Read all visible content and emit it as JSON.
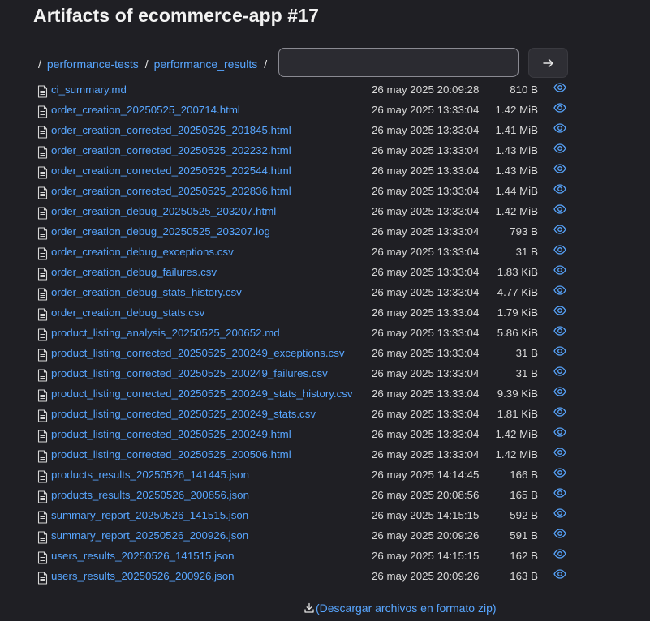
{
  "page_title": "Artifacts of ecommerce-app #17",
  "breadcrumb": {
    "root_separator": "/",
    "items": [
      "performance-tests",
      "performance_results"
    ],
    "separator": "/"
  },
  "path_input": {
    "value": "",
    "placeholder": ""
  },
  "go_button_icon": "arrow-right-icon",
  "files": [
    {
      "name": "ci_summary.md",
      "date": "26 may 2025 20:09:28",
      "size": "810 B"
    },
    {
      "name": "order_creation_20250525_200714.html",
      "date": "26 may 2025 13:33:04",
      "size": "1.42 MiB"
    },
    {
      "name": "order_creation_corrected_20250525_201845.html",
      "date": "26 may 2025 13:33:04",
      "size": "1.41 MiB"
    },
    {
      "name": "order_creation_corrected_20250525_202232.html",
      "date": "26 may 2025 13:33:04",
      "size": "1.43 MiB"
    },
    {
      "name": "order_creation_corrected_20250525_202544.html",
      "date": "26 may 2025 13:33:04",
      "size": "1.43 MiB"
    },
    {
      "name": "order_creation_corrected_20250525_202836.html",
      "date": "26 may 2025 13:33:04",
      "size": "1.44 MiB"
    },
    {
      "name": "order_creation_debug_20250525_203207.html",
      "date": "26 may 2025 13:33:04",
      "size": "1.42 MiB"
    },
    {
      "name": "order_creation_debug_20250525_203207.log",
      "date": "26 may 2025 13:33:04",
      "size": "793 B"
    },
    {
      "name": "order_creation_debug_exceptions.csv",
      "date": "26 may 2025 13:33:04",
      "size": "31 B"
    },
    {
      "name": "order_creation_debug_failures.csv",
      "date": "26 may 2025 13:33:04",
      "size": "1.83 KiB"
    },
    {
      "name": "order_creation_debug_stats_history.csv",
      "date": "26 may 2025 13:33:04",
      "size": "4.77 KiB"
    },
    {
      "name": "order_creation_debug_stats.csv",
      "date": "26 may 2025 13:33:04",
      "size": "1.79 KiB"
    },
    {
      "name": "product_listing_analysis_20250525_200652.md",
      "date": "26 may 2025 13:33:04",
      "size": "5.86 KiB"
    },
    {
      "name": "product_listing_corrected_20250525_200249_exceptions.csv",
      "date": "26 may 2025 13:33:04",
      "size": "31 B"
    },
    {
      "name": "product_listing_corrected_20250525_200249_failures.csv",
      "date": "26 may 2025 13:33:04",
      "size": "31 B"
    },
    {
      "name": "product_listing_corrected_20250525_200249_stats_history.csv",
      "date": "26 may 2025 13:33:04",
      "size": "9.39 KiB"
    },
    {
      "name": "product_listing_corrected_20250525_200249_stats.csv",
      "date": "26 may 2025 13:33:04",
      "size": "1.81 KiB"
    },
    {
      "name": "product_listing_corrected_20250525_200249.html",
      "date": "26 may 2025 13:33:04",
      "size": "1.42 MiB"
    },
    {
      "name": "product_listing_corrected_20250525_200506.html",
      "date": "26 may 2025 13:33:04",
      "size": "1.42 MiB"
    },
    {
      "name": "products_results_20250526_141445.json",
      "date": "26 may 2025 14:14:45",
      "size": "166 B"
    },
    {
      "name": "products_results_20250526_200856.json",
      "date": "26 may 2025 20:08:56",
      "size": "165 B"
    },
    {
      "name": "summary_report_20250526_141515.json",
      "date": "26 may 2025 14:15:15",
      "size": "592 B"
    },
    {
      "name": "summary_report_20250526_200926.json",
      "date": "26 may 2025 20:09:26",
      "size": "591 B"
    },
    {
      "name": "users_results_20250526_141515.json",
      "date": "26 may 2025 14:15:15",
      "size": "162 B"
    },
    {
      "name": "users_results_20250526_200926.json",
      "date": "26 may 2025 20:09:26",
      "size": "163 B"
    }
  ],
  "download_zip_label": "(Descargar archivos en formato zip)",
  "colors": {
    "background": "#1f1f24",
    "link": "#58a6ff",
    "text": "#d8d8d8"
  }
}
